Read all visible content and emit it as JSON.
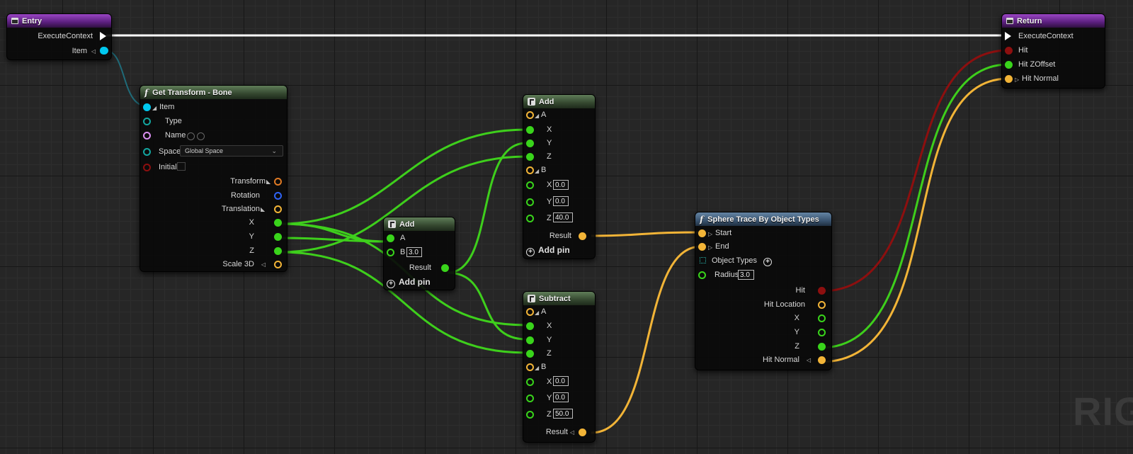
{
  "colors": {
    "exec": "#ffffff",
    "cyan": "#00c8f0",
    "teal": "#13a6a0",
    "pink": "#d98ff0",
    "darkred": "#8d0f0f",
    "orange": "#f2b437",
    "blue": "#2f63f5",
    "green": "#39d41b"
  },
  "entry": {
    "title": "Entry",
    "execute_context": "ExecuteContext",
    "item": "Item"
  },
  "return_node": {
    "title": "Return",
    "execute_context": "ExecuteContext",
    "hit": "Hit",
    "hit_zoffset": "Hit ZOffset",
    "hit_normal": "Hit Normal"
  },
  "get_transform": {
    "title": "Get Transform - Bone",
    "item": "Item",
    "type": "Type",
    "name": "Name",
    "space": "Space",
    "space_value": "Global Space",
    "initial": "Initial",
    "transform": "Transform",
    "rotation": "Rotation",
    "translation": "Translation",
    "x": "X",
    "y": "Y",
    "z": "Z",
    "scale": "Scale 3D"
  },
  "add_small": {
    "title": "Add",
    "a": "A",
    "b": "B",
    "b_value": "3.0",
    "result": "Result",
    "add_pin": "Add pin"
  },
  "add_big": {
    "title": "Add",
    "a": "A",
    "x": "X",
    "y": "Y",
    "z": "Z",
    "b": "B",
    "bx": "0.0",
    "by": "0.0",
    "bz": "40.0",
    "result": "Result",
    "add_pin": "Add pin"
  },
  "subtract": {
    "title": "Subtract",
    "a": "A",
    "x": "X",
    "y": "Y",
    "z": "Z",
    "b": "B",
    "bx": "0.0",
    "by": "0.0",
    "bz": "50.0",
    "result": "Result"
  },
  "sphere": {
    "title": "Sphere Trace By Object Types",
    "start": "Start",
    "end": "End",
    "object_types": "Object Types",
    "radius": "Radius",
    "radius_value": "3.0",
    "hit": "Hit",
    "hit_location": "Hit Location",
    "x": "X",
    "y": "Y",
    "z": "Z",
    "hit_normal": "Hit Normal"
  },
  "watermark": "RIG"
}
